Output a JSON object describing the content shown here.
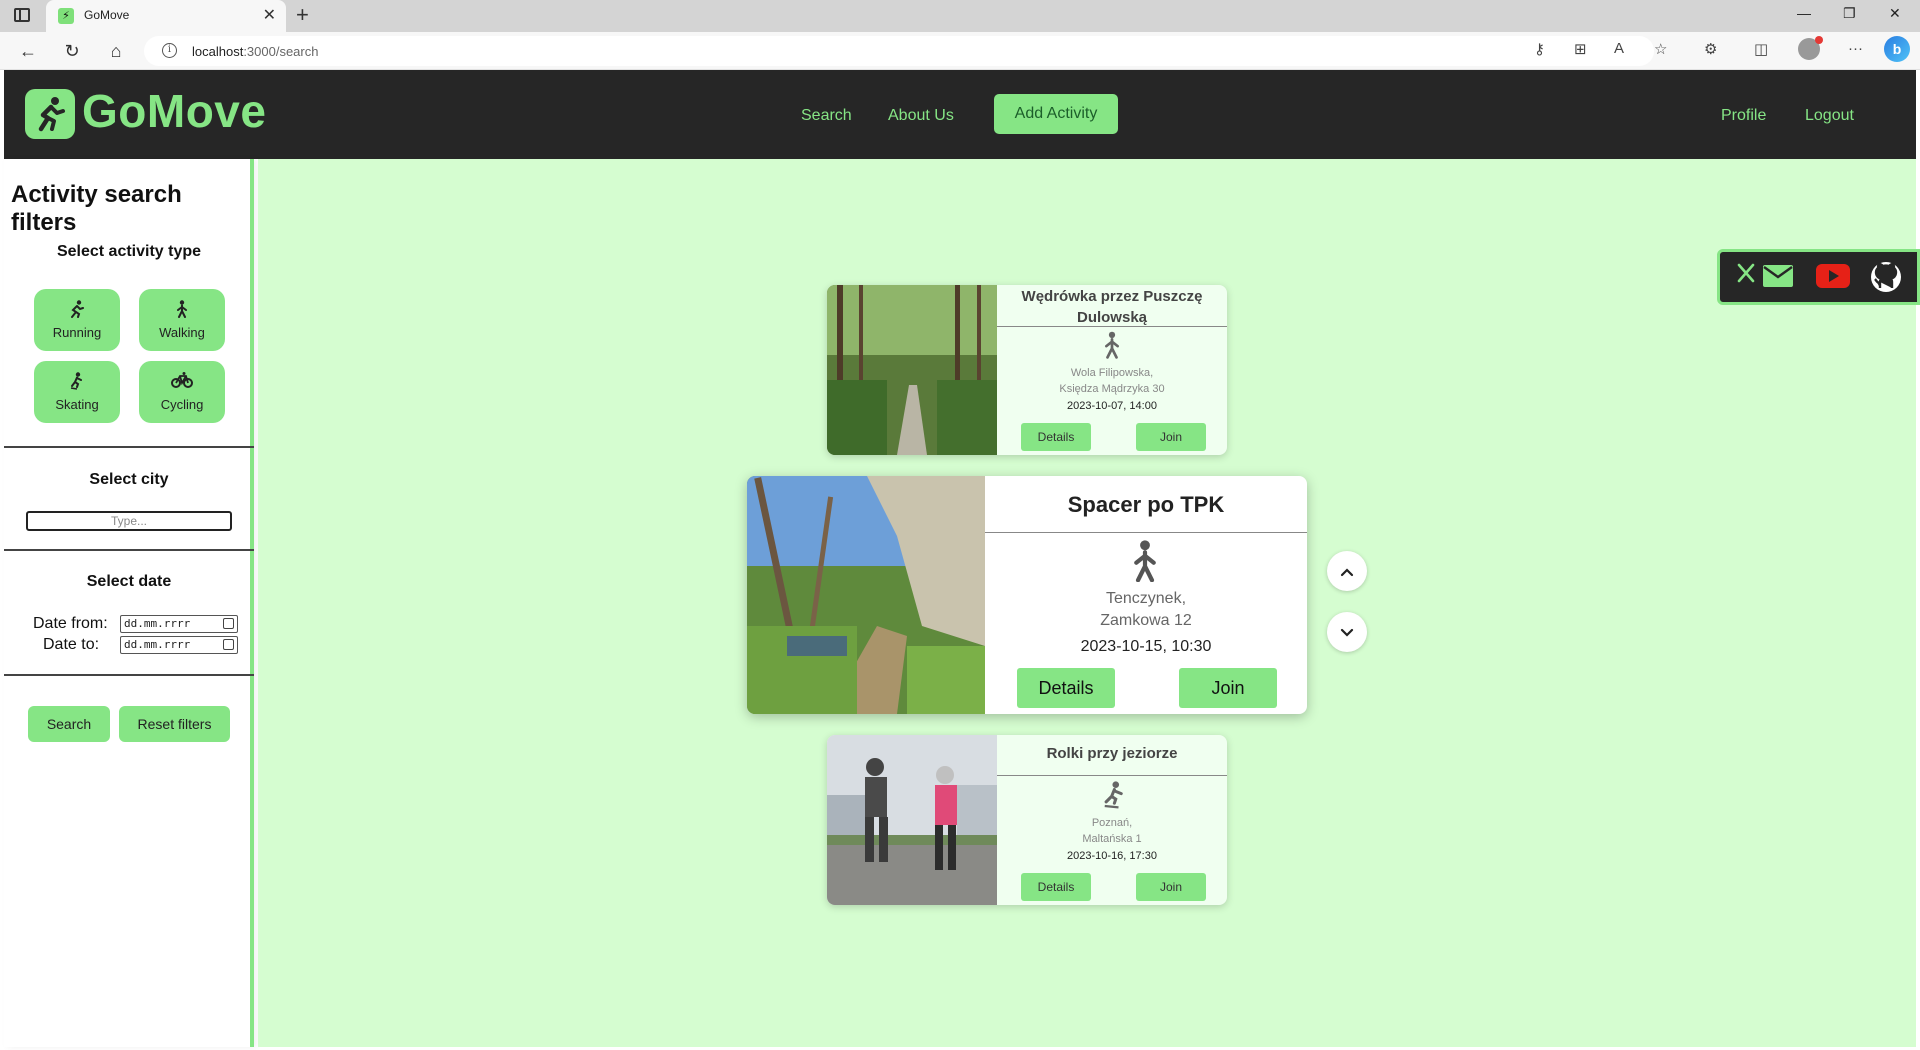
{
  "browser": {
    "tab_title": "GoMove",
    "url_host": "localhost",
    "url_rest": ":3000/search"
  },
  "header": {
    "logo_text": "GoMove",
    "nav": {
      "search": "Search",
      "about": "About Us",
      "add_activity": "Add Activity",
      "profile": "Profile",
      "logout": "Logout"
    }
  },
  "sidebar": {
    "title": "Activity search filters",
    "activity_type_heading": "Select activity type",
    "activity_types": [
      {
        "label": "Running",
        "icon": "running-icon"
      },
      {
        "label": "Walking",
        "icon": "walking-icon"
      },
      {
        "label": "Skating",
        "icon": "skating-icon"
      },
      {
        "label": "Cycling",
        "icon": "cycling-icon"
      }
    ],
    "city_heading": "Select city",
    "city_placeholder": "Type...",
    "date_heading": "Select date",
    "date_from_label": "Date from:",
    "date_to_label": "Date to:",
    "date_placeholder": "dd.mm.rrrr",
    "search_button": "Search",
    "reset_button": "Reset filters"
  },
  "activities": [
    {
      "title": "Wędrówka przez Puszczę Dulowską",
      "type": "walking",
      "address_line1": "Wola Filipowska,",
      "address_line2": "Księdza Mądrzyka 30",
      "datetime": "2023-10-07, 14:00",
      "details_label": "Details",
      "join_label": "Join"
    },
    {
      "title": "Spacer po TPK",
      "type": "walking",
      "address_line1": "Tenczynek,",
      "address_line2": "Zamkowa 12",
      "datetime": "2023-10-15, 10:30",
      "details_label": "Details",
      "join_label": "Join"
    },
    {
      "title": "Rolki przy jeziorze",
      "type": "skating",
      "address_line1": "Poznań,",
      "address_line2": "Maltańska 1",
      "datetime": "2023-10-16, 17:30",
      "details_label": "Details",
      "join_label": "Join"
    }
  ],
  "carousel": {
    "up_icon": "chevron-up-icon",
    "down_icon": "chevron-down-icon"
  },
  "social": [
    "x-icon",
    "mail-icon",
    "youtube-icon",
    "github-icon"
  ],
  "colors": {
    "accent": "#86e585",
    "header_bg": "#262626",
    "main_bg": "#d5fdd0"
  }
}
